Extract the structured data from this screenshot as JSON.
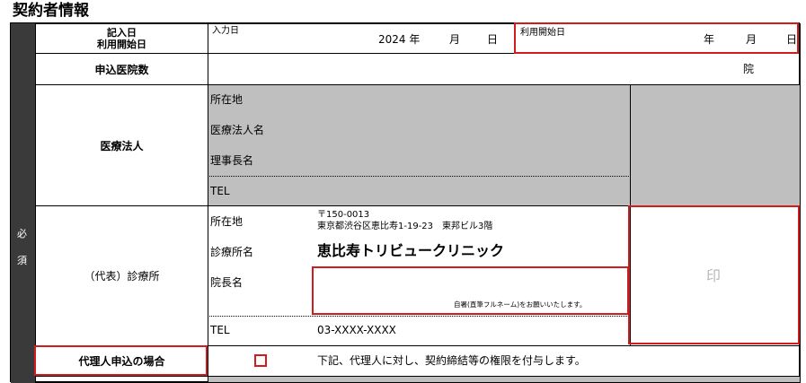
{
  "section_title": "契約者情報",
  "side_label": {
    "char1": "必",
    "char2": "須"
  },
  "row_dates": {
    "label_line1": "記入日",
    "label_line2": "利用開始日",
    "entry_prefix": "入力日",
    "entry_year": "2024 年",
    "entry_month": "月",
    "entry_day": "日",
    "start_prefix": "利用開始日",
    "start_year": "年",
    "start_month": "月",
    "start_day": "日"
  },
  "row_hospitals": {
    "label": "申込医院数",
    "unit": "院"
  },
  "row_corporation": {
    "label": "医療法人",
    "fields": [
      "所在地",
      "医療法人名",
      "理事長名",
      "TEL"
    ]
  },
  "row_clinic": {
    "label": "（代表）診療所",
    "address_label": "所在地",
    "postal": "〒150-0013",
    "address": "東京都渋谷区恵比寿1-19-23　東邦ビル3階",
    "name_label": "診療所名",
    "name_value": "恵比寿トリビュークリニック",
    "director_label": "院長名",
    "signature_note": "自署(直筆フルネーム)をお願いいたします。",
    "tel_label": "TEL",
    "tel_value": "03-XXXX-XXXX",
    "seal": "印"
  },
  "row_agent": {
    "label": "代理人申込の場合",
    "description": "下記、代理人に対し、契約締結等の権限を付与します。"
  }
}
